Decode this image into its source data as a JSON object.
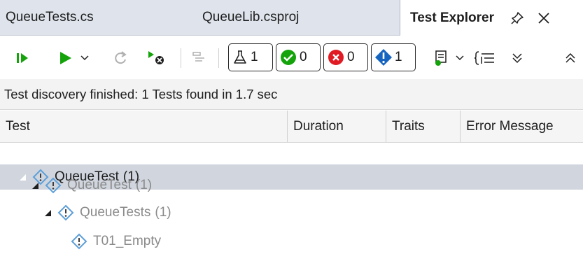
{
  "tabs": [
    {
      "label": "QueueTests.cs"
    },
    {
      "label": "QueueLib.csproj"
    },
    {
      "label": "Test Explorer"
    }
  ],
  "toolbar": {
    "counters": {
      "total": "1",
      "passed": "0",
      "failed": "0",
      "not_run": "1"
    }
  },
  "status": {
    "text": "Test discovery finished: 1 Tests found in 1.7 sec"
  },
  "columns": [
    "Test",
    "Duration",
    "Traits",
    "Error Message"
  ],
  "tree": [
    {
      "label": "QueueTest",
      "count": "(1)",
      "level": 0
    },
    {
      "label": "QueueTest",
      "count": "(1)",
      "level": 1
    },
    {
      "label": "QueueTests",
      "count": "(1)",
      "level": 2
    },
    {
      "label": "T01_Empty",
      "count": "",
      "level": 3
    }
  ],
  "colors": {
    "run_green": "#15a30b",
    "failed_red": "#e01b24",
    "notrun_blue": "#1565c0",
    "warn_blue": "#5fa0d8",
    "selected_row": "#d0d5de"
  },
  "icons": {
    "pin": "pin-icon",
    "close": "close-icon",
    "run_all": "run-all-icon",
    "run": "run-icon",
    "warning": "not-run-warning-icon"
  }
}
